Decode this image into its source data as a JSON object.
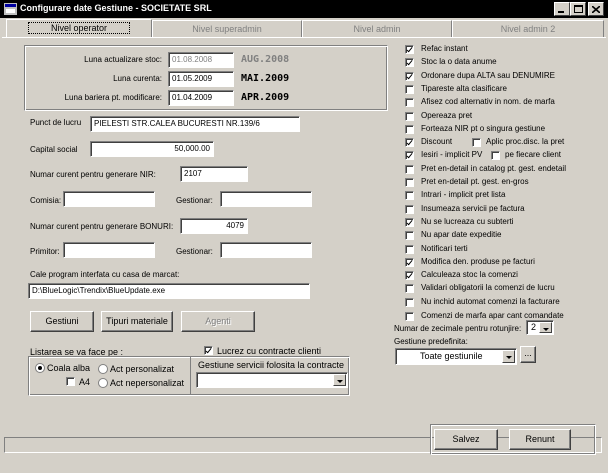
{
  "window": {
    "title": "Configurare date Gestiune - SOCIETATE SRL",
    "controls": [
      "minimize-icon",
      "maximize-icon",
      "close-icon"
    ]
  },
  "tabs": [
    {
      "label": "Nivel operator",
      "active": true
    },
    {
      "label": "Nivel superadmin",
      "active": false
    },
    {
      "label": "Nivel admin",
      "active": false
    },
    {
      "label": "Nivel admin 2",
      "active": false
    }
  ],
  "months": {
    "stock": {
      "label": "Luna actualizare stoc:",
      "value": "01.08.2008",
      "display": "AUG.2008"
    },
    "current": {
      "label": "Luna curenta:",
      "value": "01.05.2009",
      "display": "MAI.2009"
    },
    "barrier": {
      "label": "Luna bariera pt. modificare:",
      "value": "01.04.2009",
      "display": "APR.2009"
    }
  },
  "form": {
    "workpoint": {
      "label": "Punct de lucru",
      "value": "PIELESTI STR.CALEA BUCURESTI NR.139/6"
    },
    "capital": {
      "label": "Capital social",
      "value": "50,000.00"
    },
    "nir": {
      "label": "Numar curent pentru generare NIR:",
      "value": "2107"
    },
    "commission": {
      "label": "Comisia:",
      "value": ""
    },
    "manager1": {
      "label": "Gestionar:",
      "value": ""
    },
    "receipts": {
      "label": "Numar curent pentru generare BONURI:",
      "value": "4079"
    },
    "receiver": {
      "label": "Primitor:",
      "value": ""
    },
    "manager2": {
      "label": "Gestionar:",
      "value": ""
    },
    "cash_path": {
      "label": "Cale program interfata cu casa de marcat:",
      "value": "D:\\BlueLogic\\Trendix\\BlueUpdate.exe"
    }
  },
  "buttons": {
    "gestiuni": "Gestiuni",
    "materials": "Tipuri materiale",
    "agents": "Agenti",
    "save": "Salvez",
    "cancel": "Renunt",
    "browse": "..."
  },
  "listing": {
    "title": "Listarea se va face pe :",
    "paper_white": {
      "label": "Coala alba",
      "checked": true
    },
    "a4": {
      "label": "A4",
      "checked": false
    },
    "custom": {
      "label": "Act personalizat",
      "checked": false
    },
    "noncustom": {
      "label": "Act nepersonalizat",
      "checked": false
    }
  },
  "contracts": {
    "checkbox_label": "Lucrez cu contracte clienti",
    "checked": true,
    "service_label": "Gestiune servicii folosita la contracte",
    "service_value": ""
  },
  "options": [
    {
      "label": "Refac instant",
      "checked": true
    },
    {
      "label": "Stoc la o data anume",
      "checked": true
    },
    {
      "label": "Ordonare dupa ALTA sau  DENUMIRE",
      "checked": true
    },
    {
      "label": "Tipareste alta clasificare",
      "checked": false
    },
    {
      "label": "Afisez cod alternativ in nom. de marfa",
      "checked": false
    },
    {
      "label": "Opereaza pret",
      "checked": false
    },
    {
      "label": "Forteaza NIR pt o singura gestiune",
      "checked": false
    },
    {
      "label": "Discount",
      "checked": true,
      "extra": {
        "label": "Aplic proc.disc. la pret",
        "checked": false
      }
    },
    {
      "label": "Iesiri - implicit PV",
      "checked": true,
      "extra": {
        "label": "pe fiecare client",
        "checked": false
      }
    },
    {
      "label": "Pret en-detail in catalog pt. gest. endetail",
      "checked": false
    },
    {
      "label": "Pret en-detail pt. gest. en-gros",
      "checked": false
    },
    {
      "label": "Intrari - implicit pret lista",
      "checked": false
    },
    {
      "label": "Insumeaza servicii pe factura",
      "checked": false
    },
    {
      "label": "Nu se lucreaza cu subterti",
      "checked": true
    },
    {
      "label": "Nu apar date expeditie",
      "checked": false
    },
    {
      "label": "Notificari terti",
      "checked": false
    },
    {
      "label": "Modifica den. produse pe facturi",
      "checked": true
    },
    {
      "label": "Calculeaza stoc la comenzi",
      "checked": true
    },
    {
      "label": "Validari obligatorii la comenzi de lucru",
      "checked": false
    },
    {
      "label": "Nu inchid automat comenzi la facturare",
      "checked": false
    },
    {
      "label": "Comenzi de marfa apar cant comandate",
      "checked": false
    }
  ],
  "decimals": {
    "label": "Numar de zecimale pentru rotunjire:",
    "value": "2"
  },
  "default_gestiune": {
    "label": "Gestiune predefinita:",
    "value": "Toate gestiunile"
  }
}
